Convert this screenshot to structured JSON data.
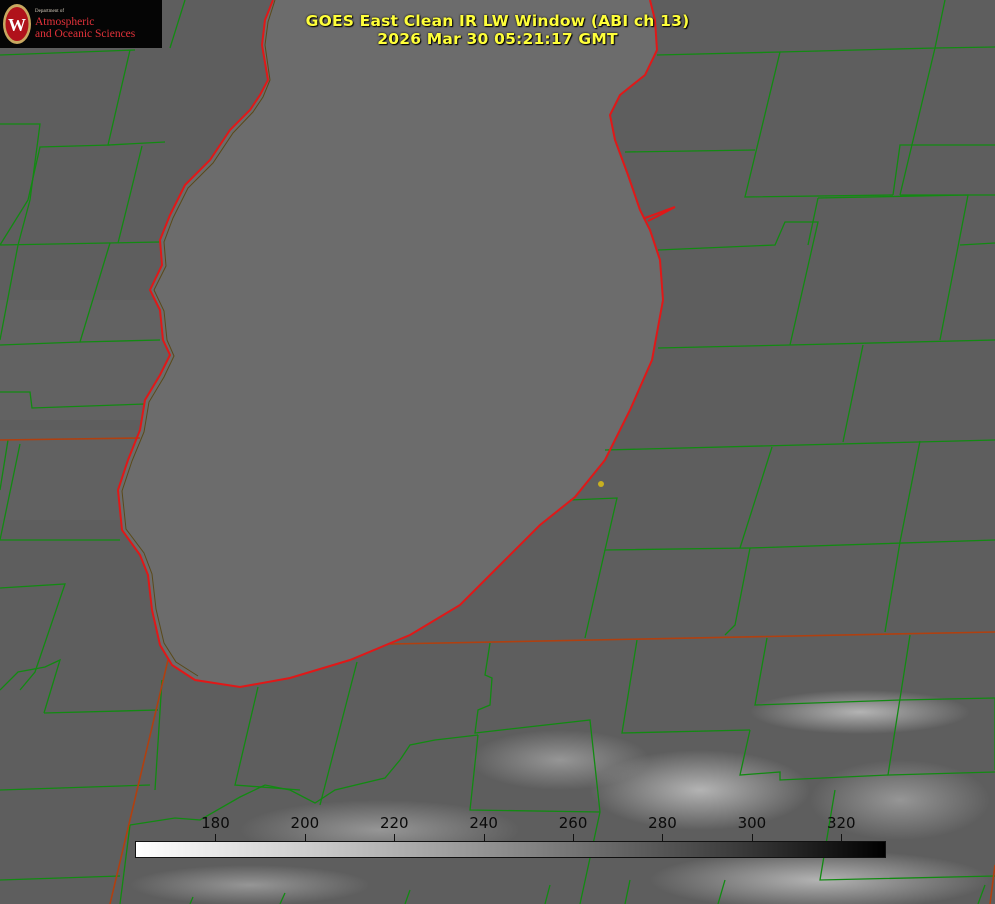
{
  "header": {
    "title_line1": "GOES East Clean IR LW Window (ABI ch 13)",
    "title_line2": "2026 Mar 30 05:21:17 GMT"
  },
  "logo": {
    "department": "Department of",
    "line1": "Atmospheric",
    "line2": "and Oceanic Sciences",
    "seal_letter": "W",
    "colors": {
      "text": "#e2323a",
      "background": "#050505"
    }
  },
  "colorbar": {
    "ticks": [
      "180",
      "200",
      "220",
      "240",
      "260",
      "280",
      "300",
      "320"
    ],
    "range": [
      162,
      330
    ]
  },
  "map": {
    "colors": {
      "background": "#5f5f5f",
      "lake": "#6d6d6d",
      "county_lines": "#128a12",
      "state_lines": "#b04010",
      "coastline": "#e01818",
      "marker": "#c8b020"
    }
  }
}
